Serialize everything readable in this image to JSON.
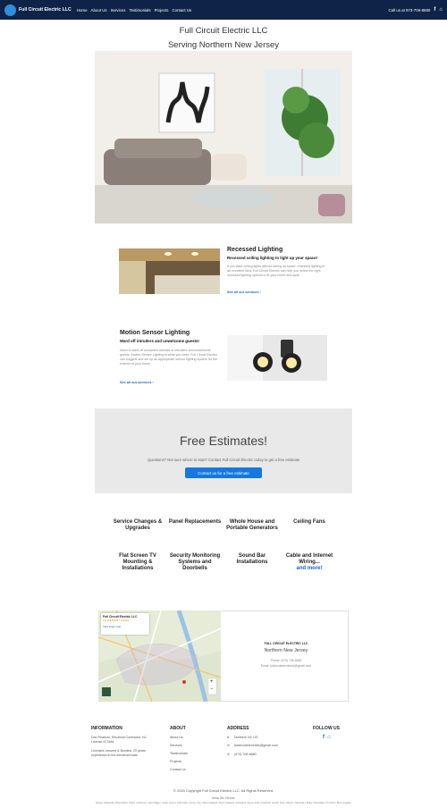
{
  "nav": {
    "brand": "Full Circuit Electric LLC",
    "menu": [
      "Home",
      "About Us",
      "Services",
      "Testimonials",
      "Projects",
      "Contact Us"
    ],
    "phone": "Call us at 973-706-8680"
  },
  "header": {
    "title": "Full Circuit Electric LLC",
    "subtitle": "Serving Northern New Jersey"
  },
  "features": [
    {
      "title": "Recessed Lighting",
      "subtitle": "Recessed ceiling lighting to light up your space!",
      "body": "If you want ceiling lights without taking up space, recessed lighting is an excellent idea. Full Circuit Electric can help you select the right recessed lighting options to fit your home and style.",
      "link": "See all our services ›"
    },
    {
      "title": "Motion Sensor Lighting",
      "subtitle": "Ward off intruders and unwelcome guests!",
      "body": "Need to ward off unwanted animals or intruders and unwelcome guests, Motion Sensor Lighting is what you need. Full Circuit Electric can suggest and set up an appropriate sensor lighting system for the exterior of your home.",
      "link": "See all our services ›"
    }
  ],
  "estimates": {
    "title": "Free Estimates!",
    "text": "Questions? Not sure where to start? Contact Full Circuit Electric today to get a free estimate",
    "button": "Contact us for a free estimate"
  },
  "services": [
    "Service Changes & Upgrades",
    "Panel Replacements",
    "Whole House and Portable Generators",
    "Ceiling Fans",
    "Flat Screen TV Mounting & Installations",
    "Security Monitoring Systems and Doorbells",
    "Sound Bar Installations",
    "Cable and Internet Wiring..."
  ],
  "services_more": "and more!",
  "map": {
    "card_title": "Full Circuit Electric LLC",
    "rating": "5.0 ★★★★★ 7 reviews",
    "larger_map": "View larger map",
    "company": "FULL CIRCUIT ELECTRIC LLC",
    "region": "Northern New Jersey",
    "phone": "Phone: (973) 706-8680",
    "email": "Email: fullcircuitelectricllc@gmail.com"
  },
  "footer": {
    "information_title": "INFORMATION",
    "information_text1": "Dan Pearson, Electrical Contractor, NJ License #17###",
    "information_text2": "Licensed, insured & Bonded. 20 years experience in the electrical trade",
    "about_title": "ABOUT",
    "about_links": [
      "About Us",
      "Services",
      "Testimonials",
      "Projects",
      "Contact Us"
    ],
    "address_title": "ADDRESS",
    "address_lines": [
      "Northern NJ, US",
      "fullcircuitelectricllc@gmail.com",
      "(973) 706-8680"
    ],
    "follow_title": "FOLLOW US"
  },
  "copyright": "© 2020 Copyright Full Circuit Electric LLC. All Rights Reserved.",
  "areas_title": "Areas We Service:",
  "towns": "Bayley | Belleville | Bloomfield | Clifton | Hoboken | Glen Ridge | Cedar Grove | Little Falls | Jersey City | West Caldwell | North Caldwell | Roseland | Essex Fells | Fairfield | Lincoln Park | Wayne | Montville | Butler | Riverdale | Kinnelon | Bloomingdale",
  "colors": {
    "nav_bg": "#0f2348",
    "accent": "#1478e0"
  }
}
